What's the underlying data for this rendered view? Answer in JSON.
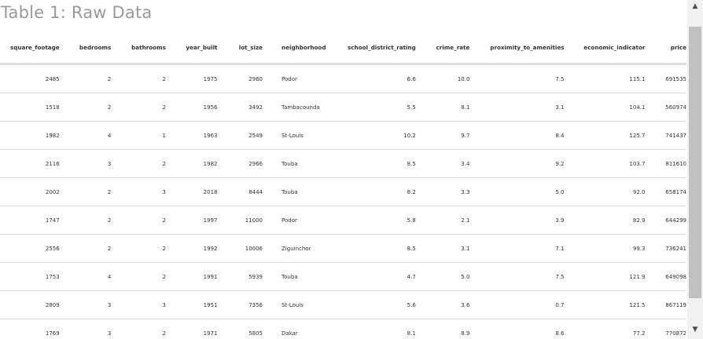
{
  "title": "Table 1: Raw Data",
  "table": {
    "columns": [
      "square_footage",
      "bedrooms",
      "bathrooms",
      "year_built",
      "lot_size",
      "neighborhood",
      "school_district_rating",
      "crime_rate",
      "proximity_to_amenities",
      "economic_indicator",
      "price"
    ],
    "rows": [
      [
        "2485",
        "2",
        "2",
        "1975",
        "2960",
        "Podor",
        "6.6",
        "10.0",
        "7.5",
        "115.1",
        "691535"
      ],
      [
        "1518",
        "2",
        "2",
        "1956",
        "3492",
        "Tambacounda",
        "5.5",
        "8.1",
        "3.1",
        "104.1",
        "560974"
      ],
      [
        "1982",
        "4",
        "1",
        "1963",
        "2549",
        "St-Louis",
        "10.2",
        "9.7",
        "8.4",
        "125.7",
        "741437"
      ],
      [
        "2116",
        "3",
        "2",
        "1982",
        "2966",
        "Touba",
        "8.5",
        "3.4",
        "9.2",
        "103.7",
        "811610"
      ],
      [
        "2002",
        "2",
        "3",
        "2018",
        "8444",
        "Touba",
        "8.2",
        "3.3",
        "5.0",
        "92.0",
        "658174"
      ],
      [
        "1747",
        "2",
        "2",
        "1997",
        "11000",
        "Podor",
        "5.8",
        "2.1",
        "3.9",
        "82.9",
        "644299"
      ],
      [
        "2556",
        "2",
        "2",
        "1992",
        "10006",
        "Ziguinchor",
        "8.5",
        "3.1",
        "7.1",
        "99.3",
        "736241"
      ],
      [
        "1753",
        "4",
        "2",
        "1991",
        "5939",
        "Touba",
        "4.7",
        "5.0",
        "7.5",
        "121.9",
        "649098"
      ],
      [
        "2809",
        "3",
        "3",
        "1951",
        "7356",
        "St-Louis",
        "5.6",
        "3.6",
        "0.7",
        "121.5",
        "867119"
      ],
      [
        "1769",
        "3",
        "2",
        "1971",
        "5805",
        "Dakar",
        "8.1",
        "8.9",
        "8.6",
        "77.2",
        "770872"
      ]
    ]
  },
  "scrollbar": {
    "up_icon": "▲",
    "down_icon": "▼"
  }
}
